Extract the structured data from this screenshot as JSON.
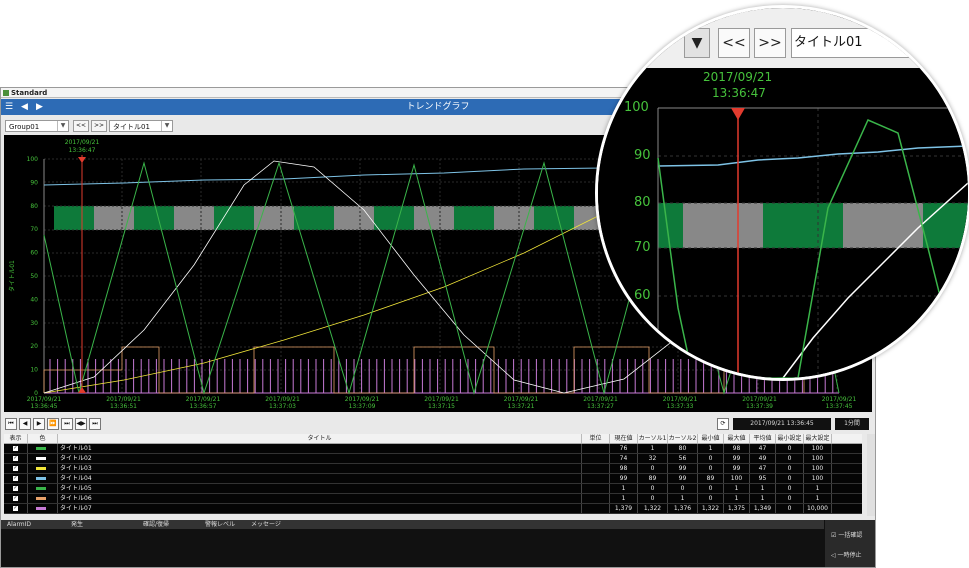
{
  "window": {
    "title": "Standard",
    "header_title": "トレンドグラフ"
  },
  "toolbar": {
    "group": "Group01",
    "prev": "<<",
    "next": ">>",
    "title_select": "タイトル01"
  },
  "chart": {
    "cursor_date": "2017/09/21",
    "cursor_time": "13:36:47",
    "y_label": "タイトル01",
    "y_ticks": [
      "100",
      "90",
      "80",
      "70",
      "60",
      "50",
      "40",
      "30",
      "20",
      "10",
      "0"
    ],
    "x_ticks": [
      {
        "date": "2017/09/21",
        "time": "13:36:45"
      },
      {
        "date": "2017/09/21",
        "time": "13:36:51"
      },
      {
        "date": "2017/09/21",
        "time": "13:36:57"
      },
      {
        "date": "2017/09/21",
        "time": "13:37:03"
      },
      {
        "date": "2017/09/21",
        "time": "13:37:09"
      },
      {
        "date": "2017/09/21",
        "time": "13:37:15"
      },
      {
        "date": "2017/09/21",
        "time": "13:37:21"
      },
      {
        "date": "2017/09/21",
        "time": "13:37:27"
      },
      {
        "date": "2017/09/21",
        "time": "13:37:33"
      },
      {
        "date": "2017/09/21",
        "time": "13:37:39"
      },
      {
        "date": "2017/09/21",
        "time": "13:37:45"
      }
    ]
  },
  "nav": {
    "buttons": [
      "⏮",
      "◀",
      "▶",
      "⏭",
      "▶|",
      "⏵⏵",
      "|▶|"
    ],
    "datetime": "2017/09/21 13:36:45",
    "interval": "1分間"
  },
  "table": {
    "headers": [
      "表示",
      "色",
      "タイトル",
      "単位",
      "現在値",
      "カーソル1",
      "カーソル2",
      "最小値",
      "最大値",
      "平均値",
      "最小設定",
      "最大設定"
    ],
    "rows": [
      {
        "color": "#3ab54a",
        "title": "タイトル01",
        "unit": "",
        "cur": "76",
        "c1": "1",
        "c2": "80",
        "min": "1",
        "max": "98",
        "avg": "47",
        "smin": "0",
        "smax": "100"
      },
      {
        "color": "#ffffff",
        "title": "タイトル02",
        "unit": "",
        "cur": "74",
        "c1": "32",
        "c2": "56",
        "min": "0",
        "max": "99",
        "avg": "49",
        "smin": "0",
        "smax": "100"
      },
      {
        "color": "#f2e63a",
        "title": "タイトル03",
        "unit": "",
        "cur": "98",
        "c1": "0",
        "c2": "99",
        "min": "0",
        "max": "99",
        "avg": "47",
        "smin": "0",
        "smax": "100"
      },
      {
        "color": "#7ec3e6",
        "title": "タイトル04",
        "unit": "",
        "cur": "99",
        "c1": "89",
        "c2": "99",
        "min": "89",
        "max": "100",
        "avg": "95",
        "smin": "0",
        "smax": "100"
      },
      {
        "color": "#3ab54a",
        "title": "タイトル05",
        "unit": "",
        "cur": "1",
        "c1": "0",
        "c2": "0",
        "min": "0",
        "max": "1",
        "avg": "1",
        "smin": "0",
        "smax": "1"
      },
      {
        "color": "#e8a26a",
        "title": "タイトル06",
        "unit": "",
        "cur": "1",
        "c1": "0",
        "c2": "1",
        "min": "0",
        "max": "1",
        "avg": "1",
        "smin": "0",
        "smax": "1"
      },
      {
        "color": "#c77ad6",
        "title": "タイトル07",
        "unit": "",
        "cur": "1,379",
        "c1": "1,322",
        "c2": "1,376",
        "min": "1,322",
        "max": "1,375",
        "avg": "1,349",
        "smin": "0",
        "smax": "10,000"
      }
    ]
  },
  "alarm": {
    "headers": [
      "AlarmID",
      "発生",
      "確認/復帰",
      "警報レベル",
      "メッセージ"
    ],
    "confirm_all": "一括確認",
    "stop_all": "一時停止"
  },
  "magnifier": {
    "prev": "<<",
    "next": ">>",
    "title_select": "タイトル01",
    "cursor_date": "2017/09/21",
    "cursor_time": "13:36:47",
    "y_ticks": [
      "100",
      "90",
      "80",
      "70",
      "60"
    ]
  }
}
